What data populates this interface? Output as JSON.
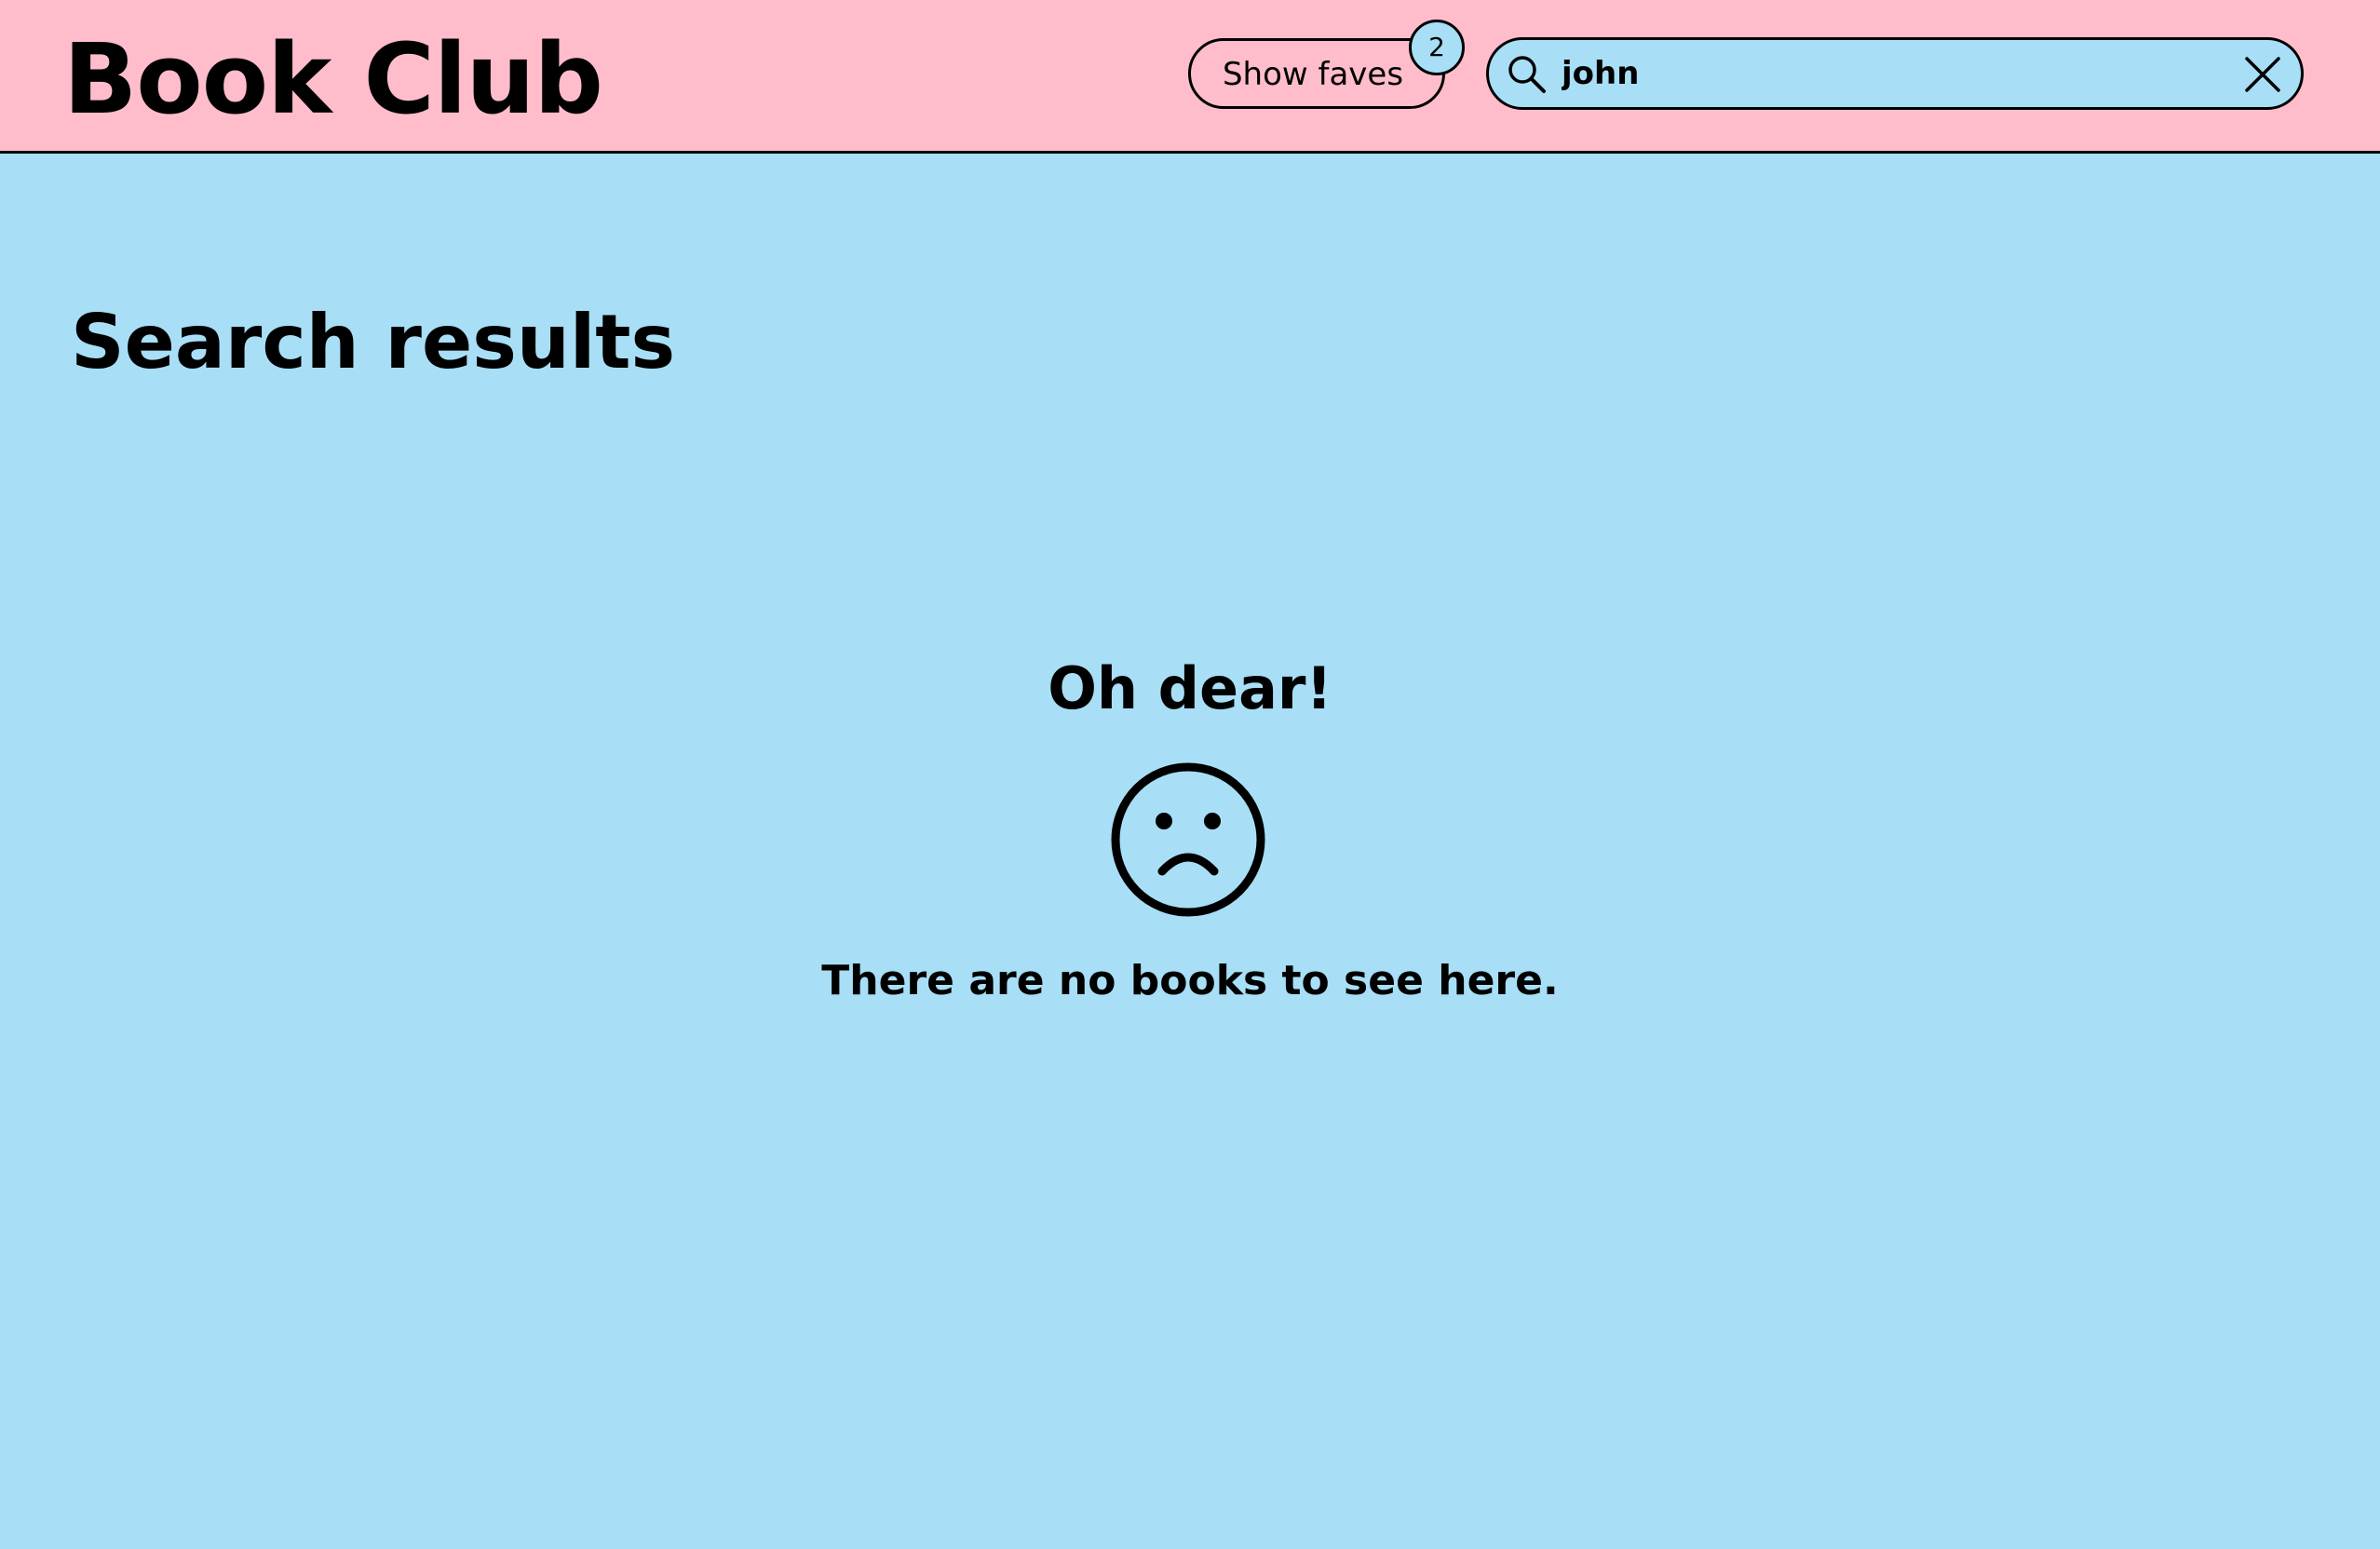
{
  "header": {
    "logo": "Book Club",
    "faves_button_label": "Show faves",
    "faves_count": "2",
    "search": {
      "value": "john",
      "icon": "search-icon",
      "clear_icon": "close-icon"
    }
  },
  "main": {
    "title": "Search results",
    "empty_state": {
      "heading": "Oh dear!",
      "icon": "sad-face-icon",
      "message": "There are no books to see here."
    }
  },
  "colors": {
    "header_background": "#ffbdcc",
    "page_background": "#a8dff6",
    "text": "#000000"
  }
}
